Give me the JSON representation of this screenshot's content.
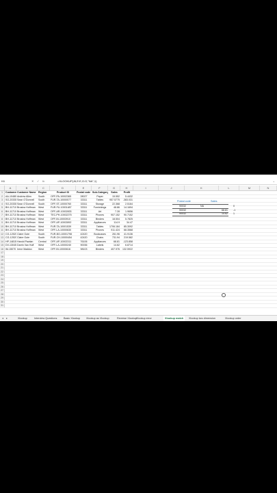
{
  "formula_bar": {
    "name_box": "K6",
    "cancel": "✕",
    "enter": "✓",
    "fx": "fx",
    "formula": "=XLOOKUP(J6,E:E,G:G,\"NA\",1)"
  },
  "columns": [
    "A",
    "B",
    "C",
    "D",
    "E",
    "F",
    "G",
    "H",
    "I",
    "J",
    "K",
    "L",
    "M",
    "N"
  ],
  "headers": {
    "customer_id": "Customer ID",
    "customer_name": "Customer Name",
    "region": "Region",
    "product_id": "Product ID",
    "postal_code": "Postal code",
    "sub_category": "Sub-Category",
    "sales": "Sales",
    "profit": "Profit"
  },
  "rows": [
    {
      "id": "AA-10480",
      "name": "Andrew Allen",
      "region": "South",
      "product": "OFF-PA-10002365",
      "postal": "28027",
      "sub": "Paper",
      "sales": "15.552",
      "profit": "5.4432"
    },
    {
      "id": "SO-20335",
      "name": "Sean O'Donnell",
      "region": "South",
      "product": "FUR-TA-10000577",
      "postal": "33311",
      "sub": "Tables",
      "sales": "957.5775",
      "profit": "-383.031"
    },
    {
      "id": "SO-20335",
      "name": "Sean O'Donnell",
      "region": "South",
      "product": "OFF-ST-10000760",
      "postal": "33311",
      "sub": "Storage",
      "sales": "22.368",
      "profit": "2.5164"
    },
    {
      "id": "BH-11710",
      "name": "Brosina Hoffman",
      "region": "West",
      "product": "FUR-FU-10001487",
      "postal": "33311",
      "sub": "Furnishings",
      "sales": "48.86",
      "profit": "14.1694"
    },
    {
      "id": "BH-11710",
      "name": "Brosina Hoffman",
      "region": "West",
      "product": "OFF-AR-10002833",
      "postal": "33311",
      "sub": "Art",
      "sales": "7.28",
      "profit": "1.9656"
    },
    {
      "id": "BH-11710",
      "name": "Brosina Hoffman",
      "region": "West",
      "product": "TEC-PH-10002275",
      "postal": "33311",
      "sub": "Phones",
      "sales": "907.152",
      "profit": "90.7152"
    },
    {
      "id": "BH-11710",
      "name": "Brosina Hoffman",
      "region": "West",
      "product": "OFF-BI-10003910",
      "postal": "33311",
      "sub": "Binders",
      "sales": "18.504",
      "profit": "5.7825"
    },
    {
      "id": "BH-11710",
      "name": "Brosina Hoffman",
      "region": "West",
      "product": "OFF-AP-10002892",
      "postal": "33311",
      "sub": "Appliances",
      "sales": "114.9",
      "profit": "34.47"
    },
    {
      "id": "BH-11710",
      "name": "Brosina Hoffman",
      "region": "West",
      "product": "FUR-TA-10001539",
      "postal": "33311",
      "sub": "Tables",
      "sales": "1706.184",
      "profit": "85.3092"
    },
    {
      "id": "BH-11710",
      "name": "Brosina Hoffman",
      "region": "West",
      "product": "OFF-LA-10000630",
      "postal": "33311",
      "sub": "Phones",
      "sales": "911.424",
      "profit": "68.3568"
    },
    {
      "id": "CG-12520",
      "name": "Claire Gute",
      "region": "South",
      "product": "FUR-BO-10001798",
      "postal": "42420",
      "sub": "Bookcases",
      "sales": "261.96",
      "profit": "41.9136"
    },
    {
      "id": "CG-12520",
      "name": "Claire Gute",
      "region": "South",
      "product": "FUR-CH-10000454",
      "postal": "42420",
      "sub": "Chairs",
      "sales": "731.94",
      "profit": "219.582"
    },
    {
      "id": "HP-14815",
      "name": "Harold Pawlan",
      "region": "Central",
      "product": "OFF-AP-10002311",
      "postal": "76106",
      "sub": "Appliances",
      "sales": "68.81",
      "profit": "-123.858"
    },
    {
      "id": "DV-13045",
      "name": "Darrin Van Huff",
      "region": "West",
      "product": "OFF-LA-10000240",
      "postal": "90036",
      "sub": "Labels",
      "sales": "14.62",
      "profit": "6.8714"
    },
    {
      "id": "IM-15070",
      "name": "Irene Maddox",
      "region": "West",
      "product": "OFF-BI-10000616",
      "postal": "98103",
      "sub": "Binders",
      "sales": "407.976",
      "profit": "132.5922"
    }
  ],
  "row_numbers": [
    "1",
    "2",
    "3",
    "4",
    "5",
    "6",
    "7",
    "8",
    "9",
    "10",
    "11",
    "12",
    "13",
    "14",
    "15",
    "16",
    "17",
    "18",
    "19",
    "20",
    "21",
    "22",
    "23",
    "24",
    "25",
    "26",
    "27",
    "28",
    "29",
    "30",
    "31"
  ],
  "lookup": {
    "postal_header": "Postal code",
    "sales_header": "Sales",
    "rows": [
      {
        "postal": "90032",
        "sales": "NA",
        "side": "0"
      },
      {
        "postal": "90032",
        "sales": "68.81",
        "side": "-1"
      },
      {
        "postal": "90032",
        "sales": "14.62",
        "side": "1"
      }
    ]
  },
  "tabs": {
    "items": [
      "Xlookup",
      "Interview Questions",
      "Basic Xlookup",
      "Xlookup as Vlookup",
      "Reverse Xlookup",
      "Xlookup error",
      "Xlookup match",
      "Xlookup two dimension",
      "Xlookup order"
    ],
    "active": "Xlookup match"
  },
  "colors": {
    "accent": "#1e7145",
    "header_text": "#1f6fb2"
  }
}
